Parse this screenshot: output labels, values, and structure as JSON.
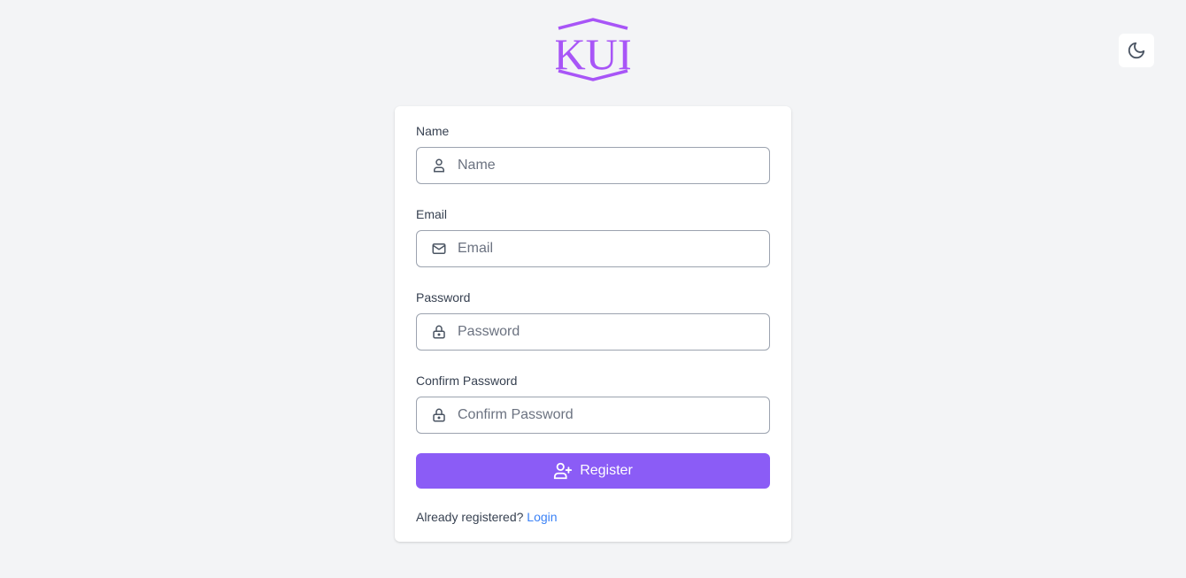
{
  "brand": {
    "logo_text": "KUI",
    "accent": "#8b5cf6",
    "logo_color": "#a855f7"
  },
  "header": {
    "theme_toggle_icon": "moon-icon"
  },
  "form": {
    "fields": [
      {
        "label": "Name",
        "placeholder": "Name",
        "value": "",
        "icon": "user-icon",
        "type": "text"
      },
      {
        "label": "Email",
        "placeholder": "Email",
        "value": "",
        "icon": "mail-icon",
        "type": "email"
      },
      {
        "label": "Password",
        "placeholder": "Password",
        "value": "",
        "icon": "lock-icon",
        "type": "password"
      },
      {
        "label": "Confirm Password",
        "placeholder": "Confirm Password",
        "value": "",
        "icon": "lock-icon",
        "type": "password"
      }
    ],
    "submit_label": "Register",
    "submit_icon": "user-plus-icon",
    "footer_prompt": "Already registered?",
    "footer_link": "Login",
    "link_color": "#3b82f6"
  }
}
